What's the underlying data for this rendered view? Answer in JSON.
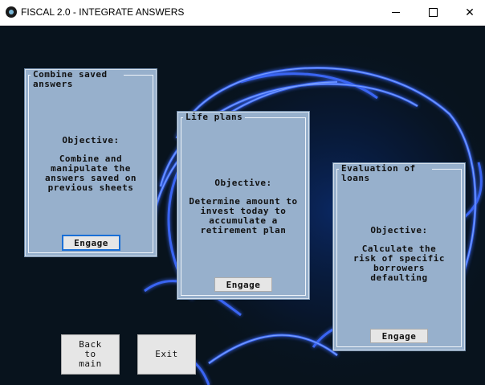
{
  "window": {
    "title": "FISCAL 2.0 - INTEGRATE ANSWERS",
    "minimize_glyph": "—",
    "maximize_glyph": "☐",
    "close_glyph": "✕"
  },
  "panels": [
    {
      "title": "Combine saved answers",
      "objective_label": "Objective:",
      "description": "Combine and manipulate the answers saved on previous sheets",
      "button_label": "Engage"
    },
    {
      "title": "Life plans",
      "objective_label": "Objective:",
      "description": "Determine amount to invest today to accumulate a retirement plan",
      "button_label": "Engage"
    },
    {
      "title": "Evaluation of loans",
      "objective_label": "Objective:",
      "description": "Calculate the risk of specific borrowers defaulting",
      "button_label": "Engage"
    }
  ],
  "footer": {
    "back_label": "Back to main",
    "exit_label": "Exit"
  },
  "colors": {
    "panel_bg": "#97b0cc",
    "background": "#08131d",
    "glow": "#2a5cff",
    "focus_border": "#1a6fd6"
  }
}
